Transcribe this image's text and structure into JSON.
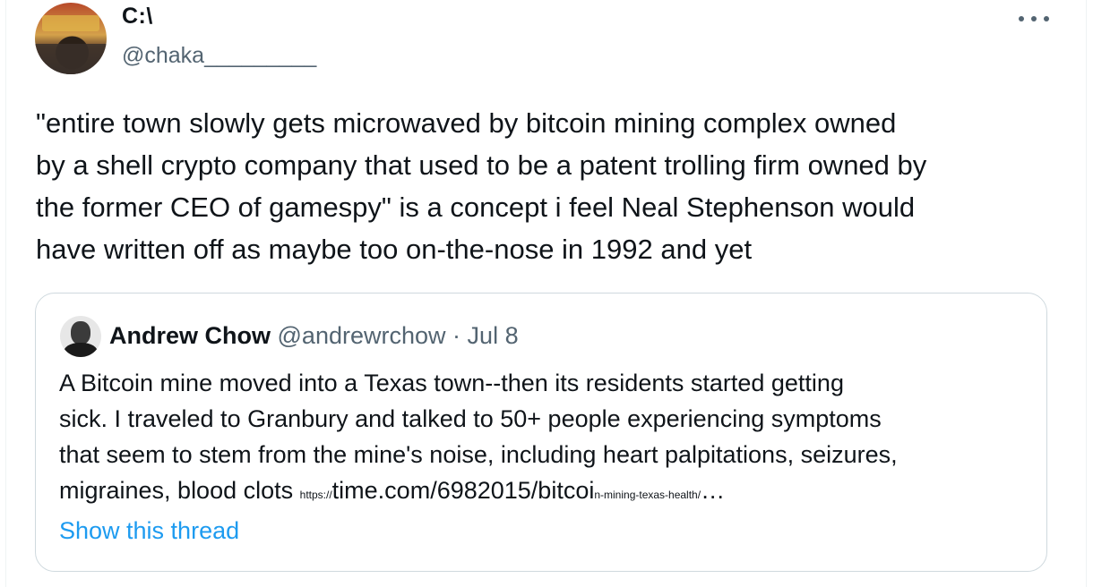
{
  "tweet": {
    "display_name": "C:\\",
    "handle": "@chaka_________",
    "more_icon": "more-horizontal-icon",
    "text_lines": [
      "\"entire town slowly gets microwaved by bitcoin mining complex owned",
      "by a shell crypto company that used to be a patent trolling firm owned by",
      "the former CEO of gamespy\" is a concept i feel Neal Stephenson would",
      "have written off as maybe too on-the-nose in 1992 and yet"
    ]
  },
  "quote": {
    "name": "Andrew Chow",
    "handle": "@andrewrchow",
    "separator": "·",
    "date": "Jul 8",
    "text_lines": [
      "A Bitcoin mine moved into a Texas town--then its residents started getting",
      "sick. I traveled to Granbury and talked to 50+ people experiencing symptoms",
      "that seem to stem from the mine's noise, including heart palpitations, seizures,",
      "migraines, blood clots "
    ],
    "link_prefix": "https://",
    "link_main": "time.com/6982015/bitcoi",
    "link_suffix": "n-mining-texas-health/",
    "link_ellipsis": "…",
    "show_thread": "Show this thread"
  },
  "colors": {
    "text": "#0f1419",
    "secondary": "#536471",
    "link": "#1d9bf0",
    "border": "#cfd9de"
  }
}
